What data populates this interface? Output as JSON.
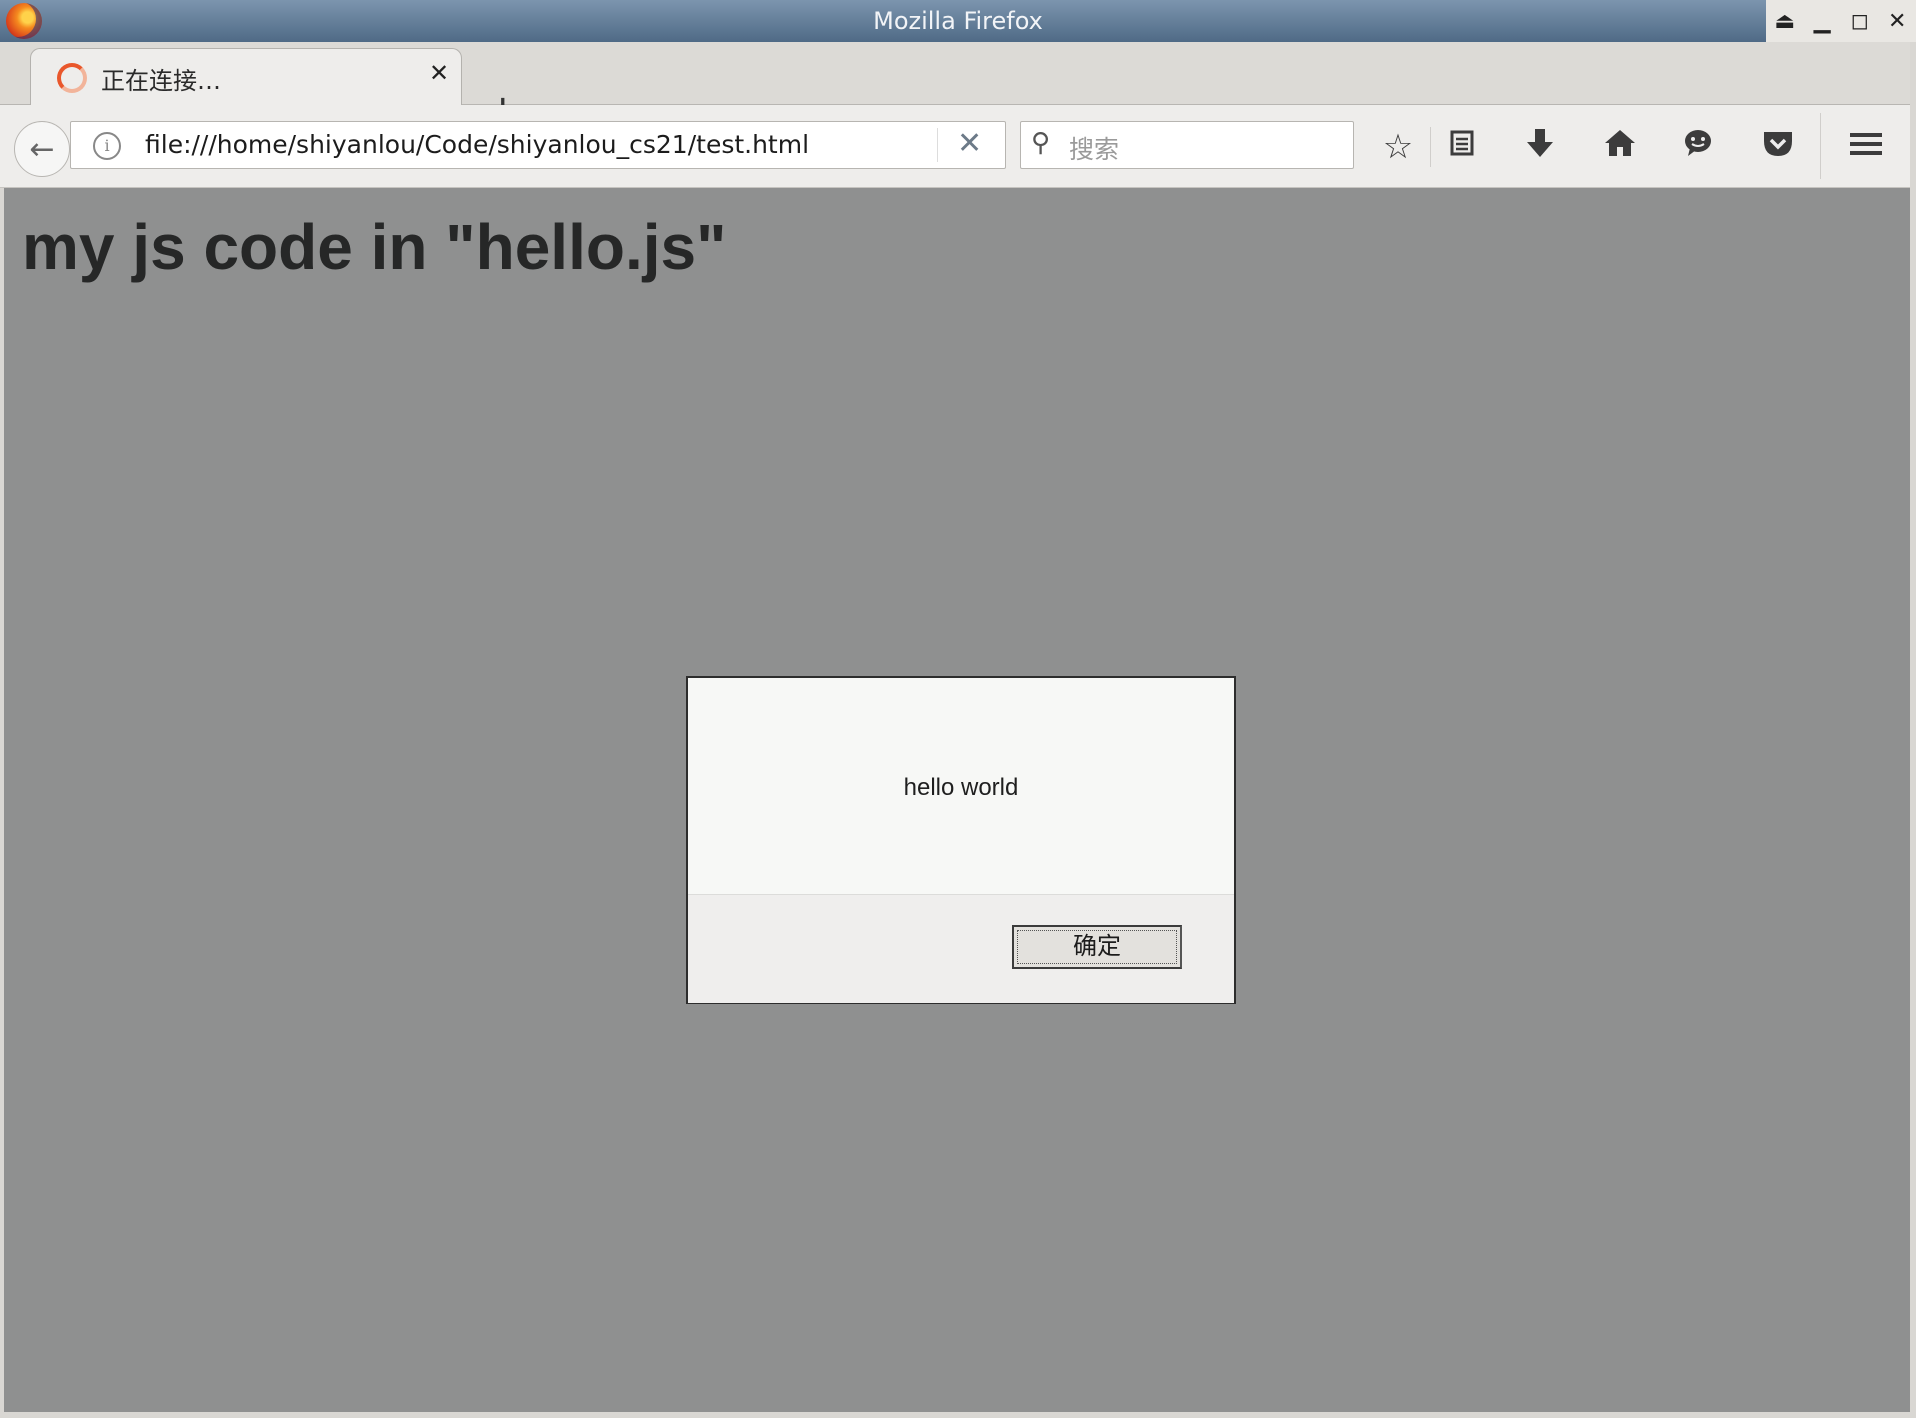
{
  "window": {
    "title": "Mozilla Firefox",
    "controls": {
      "eject": "⏏",
      "minimize": "▁",
      "maximize": "◻",
      "close": "✕"
    }
  },
  "tab": {
    "label": "正在连接…",
    "close": "✕",
    "new_tab": "+"
  },
  "navbar": {
    "back": "←",
    "info": "i",
    "url": "file:///home/shiyanlou/Code/shiyanlou_cs21/test.html",
    "stop": "✕",
    "search_placeholder": "搜索"
  },
  "toolbar_icons": [
    "bookmark-star-icon",
    "reading-list-icon",
    "download-icon",
    "home-icon",
    "chat-icon",
    "pocket-icon",
    "menu-icon"
  ],
  "page": {
    "heading": "my js code in \"hello.js\""
  },
  "dialog": {
    "message": "hello world",
    "ok_label": "确定"
  }
}
